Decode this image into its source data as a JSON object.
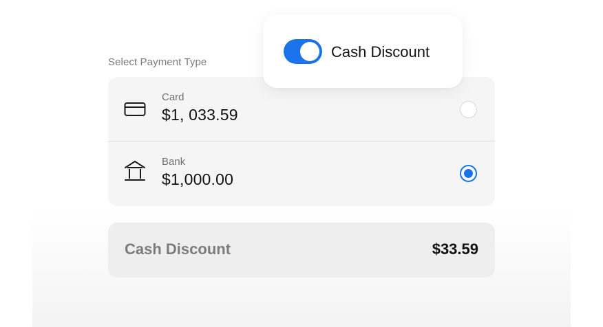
{
  "payment": {
    "section_label": "Select Payment Type",
    "options": [
      {
        "label": "Card",
        "amount": "$1, 033.59",
        "selected": false,
        "icon": "credit-card-icon"
      },
      {
        "label": "Bank",
        "amount": "$1,000.00",
        "selected": true,
        "icon": "bank-icon"
      }
    ]
  },
  "summary": {
    "label": "Cash Discount",
    "value": "$33.59"
  },
  "toggle": {
    "label": "Cash Discount",
    "enabled": true
  },
  "colors": {
    "accent": "#1a73e8"
  }
}
